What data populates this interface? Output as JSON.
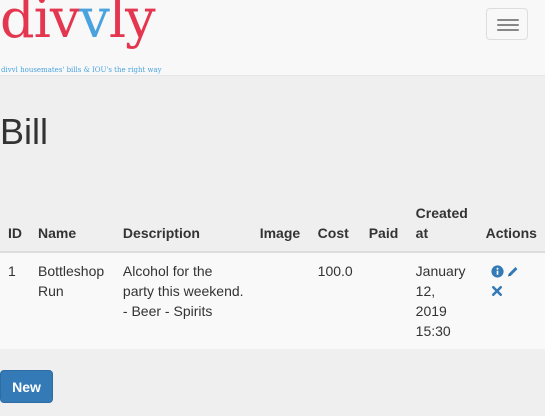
{
  "brand": {
    "logo_prefix": "div",
    "logo_accent": "v",
    "logo_suffix": "ly",
    "tagline": "divvl housemates' bills & IOU's the right way"
  },
  "page": {
    "title": "Bill"
  },
  "table": {
    "headers": {
      "id": "ID",
      "name": "Name",
      "description": "Description",
      "image": "Image",
      "cost": "Cost",
      "paid": "Paid",
      "created_at": "Created at",
      "actions": "Actions"
    },
    "rows": [
      {
        "id": "1",
        "name": "Bottleshop Run",
        "description": "Alcohol for the party this weekend. - Beer - Spirits",
        "image": "",
        "cost": "100.0",
        "paid": "",
        "created_at": "January 12, 2019 15:30",
        "actions": [
          "info-icon",
          "pencil-icon",
          "delete-icon"
        ]
      }
    ]
  },
  "buttons": {
    "new_label": "New"
  },
  "colors": {
    "logo_primary": "#e5364f",
    "logo_accent": "#4aa3df",
    "action_icon": "#337ab7",
    "button_primary": "#337ab7"
  }
}
